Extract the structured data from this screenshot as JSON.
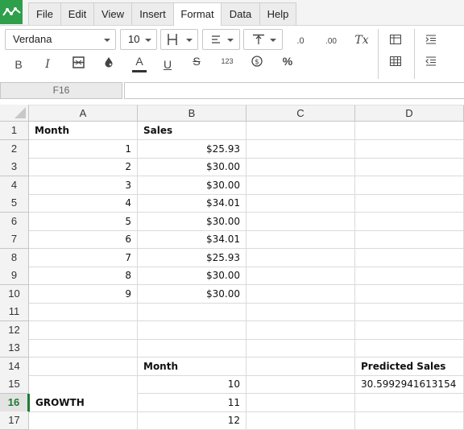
{
  "menu": {
    "items": [
      {
        "label": "File",
        "active": false
      },
      {
        "label": "Edit",
        "active": false
      },
      {
        "label": "View",
        "active": false
      },
      {
        "label": "Insert",
        "active": false
      },
      {
        "label": "Format",
        "active": true
      },
      {
        "label": "Data",
        "active": false
      },
      {
        "label": "Help",
        "active": false
      }
    ]
  },
  "toolbar": {
    "font_family": "Verdana",
    "font_size": "10",
    "bold_label": "B",
    "italic_label": "I",
    "underline_label": "U",
    "strike_label": "S",
    "text_color_label": "A",
    "number_format_label": "123",
    "percent_label": "%",
    "clear_format_label": "Tx",
    "decrease_decimal_label": ".0",
    "increase_decimal_label": ".00"
  },
  "name_box": "F16",
  "formula_value": "",
  "columns": [
    "A",
    "B",
    "C",
    "D"
  ],
  "selected_row": "16",
  "rows": [
    {
      "num": "1",
      "A": "Month",
      "B": "Sales",
      "C": "",
      "D": ""
    },
    {
      "num": "2",
      "A": "1",
      "B": "$25.93",
      "C": "",
      "D": ""
    },
    {
      "num": "3",
      "A": "2",
      "B": "$30.00",
      "C": "",
      "D": ""
    },
    {
      "num": "4",
      "A": "3",
      "B": "$30.00",
      "C": "",
      "D": ""
    },
    {
      "num": "5",
      "A": "4",
      "B": "$34.01",
      "C": "",
      "D": ""
    },
    {
      "num": "6",
      "A": "5",
      "B": "$30.00",
      "C": "",
      "D": ""
    },
    {
      "num": "7",
      "A": "6",
      "B": "$34.01",
      "C": "",
      "D": ""
    },
    {
      "num": "8",
      "A": "7",
      "B": "$25.93",
      "C": "",
      "D": ""
    },
    {
      "num": "9",
      "A": "8",
      "B": "$30.00",
      "C": "",
      "D": ""
    },
    {
      "num": "10",
      "A": "9",
      "B": "$30.00",
      "C": "",
      "D": ""
    },
    {
      "num": "11",
      "A": "",
      "B": "",
      "C": "",
      "D": ""
    },
    {
      "num": "12",
      "A": "",
      "B": "",
      "C": "",
      "D": ""
    },
    {
      "num": "13",
      "A": "",
      "B": "",
      "C": "",
      "D": ""
    },
    {
      "num": "14",
      "A": "",
      "B": "Month",
      "C": "",
      "D": "Predicted Sales"
    },
    {
      "num": "15",
      "A": "",
      "B": "10",
      "C": "",
      "D": "30.5992941613154"
    },
    {
      "num": "16",
      "A": "GROWTH",
      "B": "11",
      "C": "",
      "D": ""
    },
    {
      "num": "17",
      "A": "",
      "B": "12",
      "C": "",
      "D": ""
    }
  ]
}
